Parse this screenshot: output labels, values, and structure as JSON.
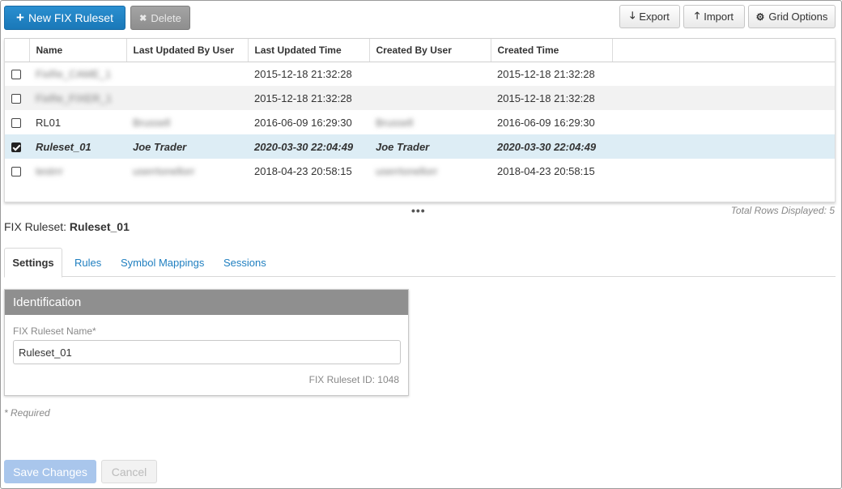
{
  "toolbar": {
    "new_label": "New FIX Ruleset",
    "delete_label": "Delete",
    "export_label": "Export",
    "import_label": "Import",
    "grid_options_label": "Grid Options"
  },
  "grid": {
    "columns": [
      "Name",
      "Last Updated By User",
      "Last Updated Time",
      "Created By User",
      "Created Time"
    ],
    "rows": [
      {
        "checked": false,
        "name": "FixRe_CAME_1",
        "updated_by": "",
        "updated_time": "2015-12-18 21:32:28",
        "created_by": "",
        "created_time": "2015-12-18 21:32:28",
        "redacted": true
      },
      {
        "checked": false,
        "name": "FixRe_FIXER_1",
        "updated_by": "",
        "updated_time": "2015-12-18 21:32:28",
        "created_by": "",
        "created_time": "2015-12-18 21:32:28",
        "redacted": true
      },
      {
        "checked": false,
        "name": "RL01",
        "updated_by": "Brussell",
        "updated_time": "2016-06-09 16:29:30",
        "created_by": "Brussell",
        "created_time": "2016-06-09 16:29:30",
        "redacted": false
      },
      {
        "checked": true,
        "name": "Ruleset_01",
        "updated_by": "Joe Trader",
        "updated_time": "2020-03-30 22:04:49",
        "created_by": "Joe Trader",
        "created_time": "2020-03-30 22:04:49",
        "redacted": false
      },
      {
        "checked": false,
        "name": "testrrr",
        "updated_by": "userrtonellorr",
        "updated_time": "2018-04-23 20:58:15",
        "created_by": "userrtonellorr",
        "created_time": "2018-04-23 20:58:15",
        "redacted": false
      }
    ],
    "more_indicator": "•••",
    "total_rows_text": "Total Rows Displayed: 5"
  },
  "detail": {
    "prefix": "FIX Ruleset:",
    "name": "Ruleset_01"
  },
  "tabs": [
    "Settings",
    "Rules",
    "Symbol Mappings",
    "Sessions"
  ],
  "panel": {
    "header": "Identification",
    "field_label": "FIX Ruleset Name*",
    "field_value": "Ruleset_01",
    "ruleset_id_text": "FIX Ruleset ID: 1048"
  },
  "required_note": "* Required",
  "footer": {
    "save_label": "Save Changes",
    "cancel_label": "Cancel"
  },
  "colors": {
    "primary": "#1a78b8",
    "selected_row": "#ddedf5",
    "link": "#1f7fc0",
    "panel_header": "#8f8f8f"
  }
}
